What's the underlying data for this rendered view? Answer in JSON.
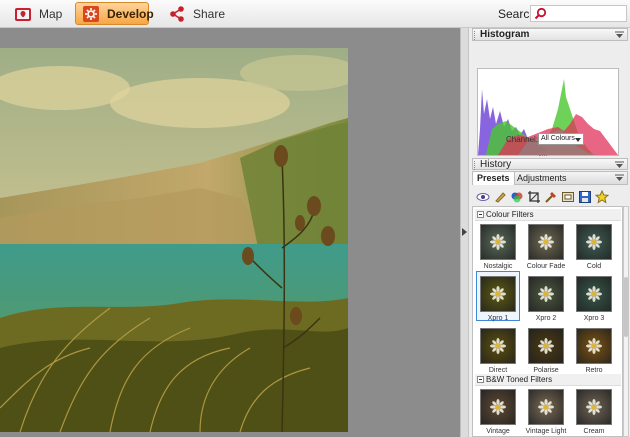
{
  "toolbar": {
    "map_label": "Map",
    "develop_label": "Develop",
    "share_label": "Share",
    "search_label": "Search"
  },
  "panel": {
    "histogram_title": "Histogram",
    "channel_label": "Channel:",
    "channel_value": "All Colours",
    "history_title": "History",
    "presets_tab": "Presets",
    "adjustments_tab": "Adjustments"
  },
  "presets": {
    "categories": [
      {
        "name": "Colour Filters",
        "items": [
          {
            "label": "Nostalgic",
            "tint": "#5a6b5a"
          },
          {
            "label": "Colour Fade",
            "tint": "#6f6a55"
          },
          {
            "label": "Cold",
            "tint": "#3f5e55"
          },
          {
            "label": "Xpro 1",
            "tint": "#5c5a12",
            "selected": true
          },
          {
            "label": "Xpro 2",
            "tint": "#4c5840"
          },
          {
            "label": "Xpro 3",
            "tint": "#37584a"
          },
          {
            "label": "Direct",
            "tint": "#5c5010"
          },
          {
            "label": "Polarise",
            "tint": "#4a3a14"
          },
          {
            "label": "Retro",
            "tint": "#7a5314"
          }
        ]
      },
      {
        "name": "B&W Toned Filters",
        "items": [
          {
            "label": "Vintage",
            "tint": "#5e4a35"
          },
          {
            "label": "Vintage Light",
            "tint": "#7a6a55"
          },
          {
            "label": "Cream",
            "tint": "#6e6455"
          }
        ]
      }
    ]
  },
  "colors": {
    "accent_orange": "#f6a745",
    "search_icon_red": "#c8102e",
    "selection_blue": "#3d86d8"
  }
}
